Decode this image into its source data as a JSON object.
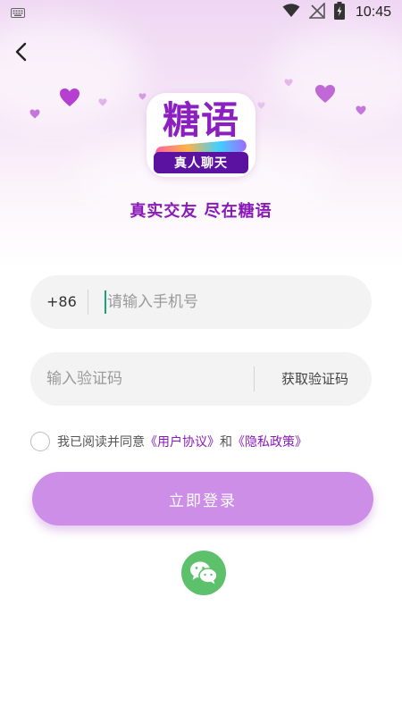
{
  "status_bar": {
    "time": "10:45",
    "icons": [
      "keyboard-icon",
      "wifi-icon",
      "no-signal-icon",
      "battery-charging-icon"
    ]
  },
  "nav": {
    "back_icon": "chevron-left-icon"
  },
  "logo": {
    "title": "糖语",
    "badge": "真人聊天",
    "colors": {
      "title": "#8b1fc0",
      "badge_bg": "#5c12a0"
    }
  },
  "slogan": "真实交友 尽在糖语",
  "phone": {
    "country_code": "+86",
    "placeholder": "请输入手机号",
    "value": ""
  },
  "verification": {
    "placeholder": "输入验证码",
    "value": "",
    "get_code_label": "获取验证码"
  },
  "agreement": {
    "checked": false,
    "prefix": "我已阅读并同意",
    "user_agreement": "《用户协议》",
    "conjunction": "和",
    "privacy_policy": "《隐私政策》"
  },
  "login_button": {
    "label": "立即登录"
  },
  "social_login": {
    "wechat_icon": "wechat-icon"
  },
  "colors": {
    "accent": "#8a1ab8",
    "button": "#cd8ee8",
    "wechat": "#5cc16a",
    "input_bg": "#f3f3f3"
  }
}
